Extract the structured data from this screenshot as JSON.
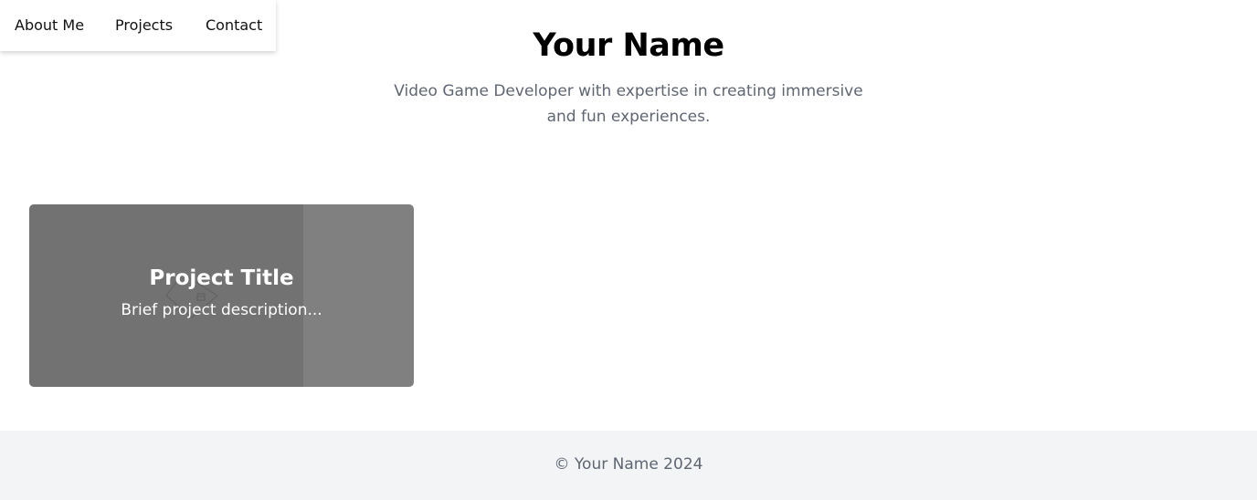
{
  "nav": {
    "items": [
      {
        "label": "About Me"
      },
      {
        "label": "Projects"
      },
      {
        "label": "Contact"
      }
    ]
  },
  "header": {
    "name": "Your Name",
    "tagline": "Video Game Developer with expertise in creating immersive and fun experiences."
  },
  "projects": [
    {
      "title": "Project Title",
      "description": "Brief project description...",
      "image_icon": "broken-image-icon"
    }
  ],
  "footer": {
    "copyright": "© Your Name 2024"
  }
}
